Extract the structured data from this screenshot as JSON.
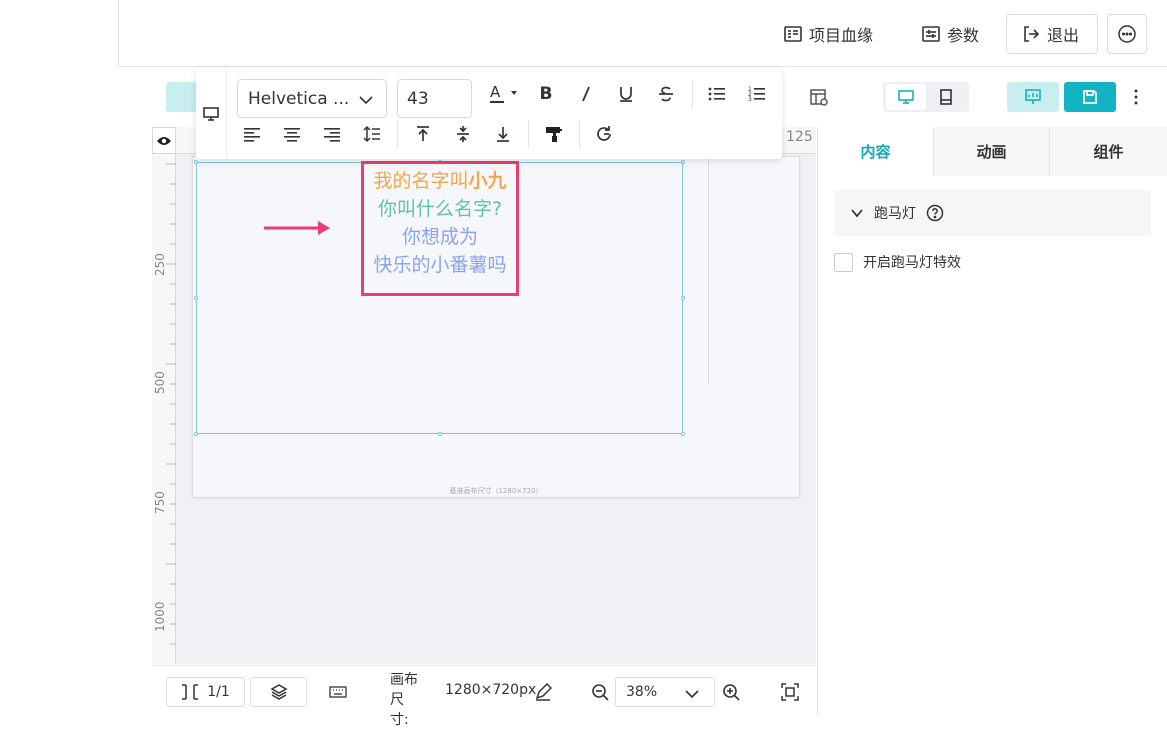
{
  "header": {
    "lineage_label": "项目血缘",
    "params_label": "参数",
    "exit_label": "退出"
  },
  "format_toolbar": {
    "font_family": "Helvetica ...",
    "font_size": "43"
  },
  "canvas": {
    "ruler_left_labels": [
      "250",
      "500",
      "750",
      "1000"
    ],
    "ruler_top_label": "125",
    "page_caption": "基准画布尺寸（1280×720）",
    "text_lines": [
      {
        "text": "我的名字叫",
        "color": "#f5a64a"
      },
      {
        "text": "小九",
        "color": "#f5a64a"
      },
      {
        "text": "你叫什么名字?",
        "color": "#5fc3a9"
      },
      {
        "text": "你想成为",
        "color": "#8aa3f0"
      },
      {
        "text": "快乐的小番薯吗",
        "color": "#8aa3f0"
      }
    ],
    "highlight_color": "#ea3d74"
  },
  "right_panel": {
    "tabs": [
      "内容",
      "动画",
      "组件"
    ],
    "section_title": "跑马灯",
    "checkbox_label": "开启跑马灯特效"
  },
  "bottom_bar": {
    "page_indicator": "1/1",
    "canvas_size_label": "画布尺寸:",
    "canvas_size_value": "1280×720px",
    "zoom_value": "38%"
  },
  "colors": {
    "accent": "#12b3c2",
    "accent_light": "#c9eef0"
  }
}
